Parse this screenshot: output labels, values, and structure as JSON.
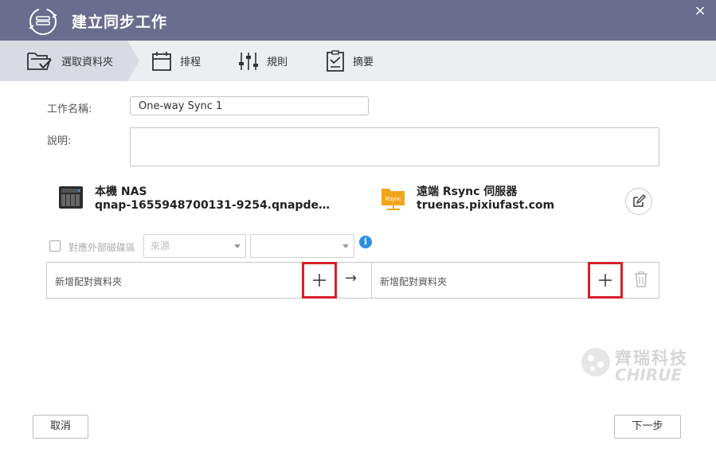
{
  "window": {
    "title": "建立同步工作",
    "close_glyph": "×"
  },
  "steps": [
    {
      "label": "選取資料夾",
      "icon": "folder-icon",
      "active": true
    },
    {
      "label": "排程",
      "icon": "calendar-icon",
      "active": false
    },
    {
      "label": "規則",
      "icon": "sliders-icon",
      "active": false
    },
    {
      "label": "摘要",
      "icon": "clipboard-icon",
      "active": false
    }
  ],
  "form": {
    "job_name_label": "工作名稱:",
    "job_name_value": "One-way Sync 1",
    "description_label": "說明:",
    "description_value": ""
  },
  "source": {
    "name": "本機 NAS",
    "host": "qnap-1655948700131-9254.qnapde…",
    "icon": "nas-device-icon"
  },
  "destination": {
    "name": "遠端 Rsync 伺服器",
    "host": "truenas.pixiufast.com",
    "icon": "rsync-server-icon",
    "icon_text": "Rsync"
  },
  "external_volume": {
    "checkbox_label": "對應外部磁碟區",
    "source_select_placeholder": "來源",
    "target_select_value": "",
    "info_glyph": "i"
  },
  "pair": {
    "source_placeholder": "新增配對資料夾",
    "target_placeholder": "新增配對資料夾",
    "arrow": "→",
    "plus_glyph": "+"
  },
  "watermark": {
    "cn": "齊瑞科技",
    "en": "CHIRUE"
  },
  "buttons": {
    "cancel": "取消",
    "next": "下一步"
  },
  "colors": {
    "titlebar": "#6a6d8e",
    "stepbar": "#eceef2",
    "step_active": "#d8dbe2",
    "highlight_box": "#d6202a",
    "info": "#2d8fe0",
    "rsync_orange": "#f2a51a"
  }
}
